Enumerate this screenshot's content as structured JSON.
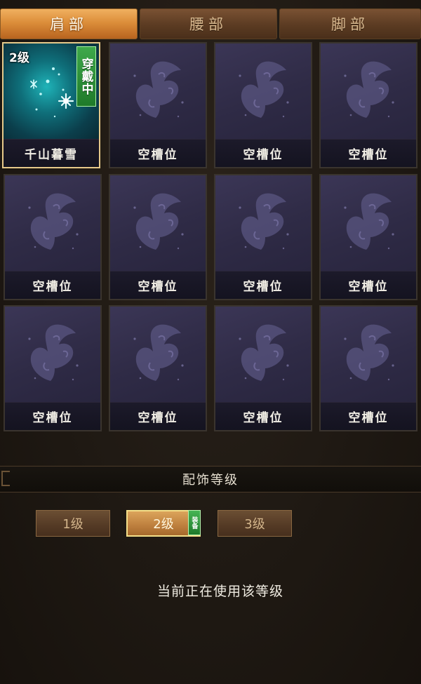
{
  "tabs": [
    {
      "label": "肩部",
      "active": true
    },
    {
      "label": "腰部",
      "active": false
    },
    {
      "label": "脚部",
      "active": false
    }
  ],
  "slots": [
    {
      "name": "千山暮雪",
      "level_tag": "2级",
      "status_tag": "穿戴中",
      "equipped": true,
      "icon": "snowflake-icon"
    },
    {
      "name": "空槽位",
      "icon": "butterfly-icon"
    },
    {
      "name": "空槽位",
      "icon": "butterfly-icon"
    },
    {
      "name": "空槽位",
      "icon": "butterfly-icon"
    },
    {
      "name": "空槽位",
      "icon": "butterfly-icon"
    },
    {
      "name": "空槽位",
      "icon": "butterfly-icon"
    },
    {
      "name": "空槽位",
      "icon": "butterfly-icon"
    },
    {
      "name": "空槽位",
      "icon": "butterfly-icon"
    },
    {
      "name": "空槽位",
      "icon": "butterfly-icon"
    },
    {
      "name": "空槽位",
      "icon": "butterfly-icon"
    },
    {
      "name": "空槽位",
      "icon": "butterfly-icon"
    },
    {
      "name": "空槽位",
      "icon": "butterfly-icon"
    }
  ],
  "level_section": {
    "title": "配饰等级",
    "buttons": [
      {
        "label": "1级",
        "active": false
      },
      {
        "label": "2级",
        "active": true
      },
      {
        "label": "3级",
        "active": false
      }
    ],
    "equip_badge": "装备",
    "status_text": "当前正在使用该等级"
  },
  "colors": {
    "tab_active": "#dc8e3a",
    "slot_bg": "#2f2b46",
    "wear_tag": "#2f9a3c"
  }
}
